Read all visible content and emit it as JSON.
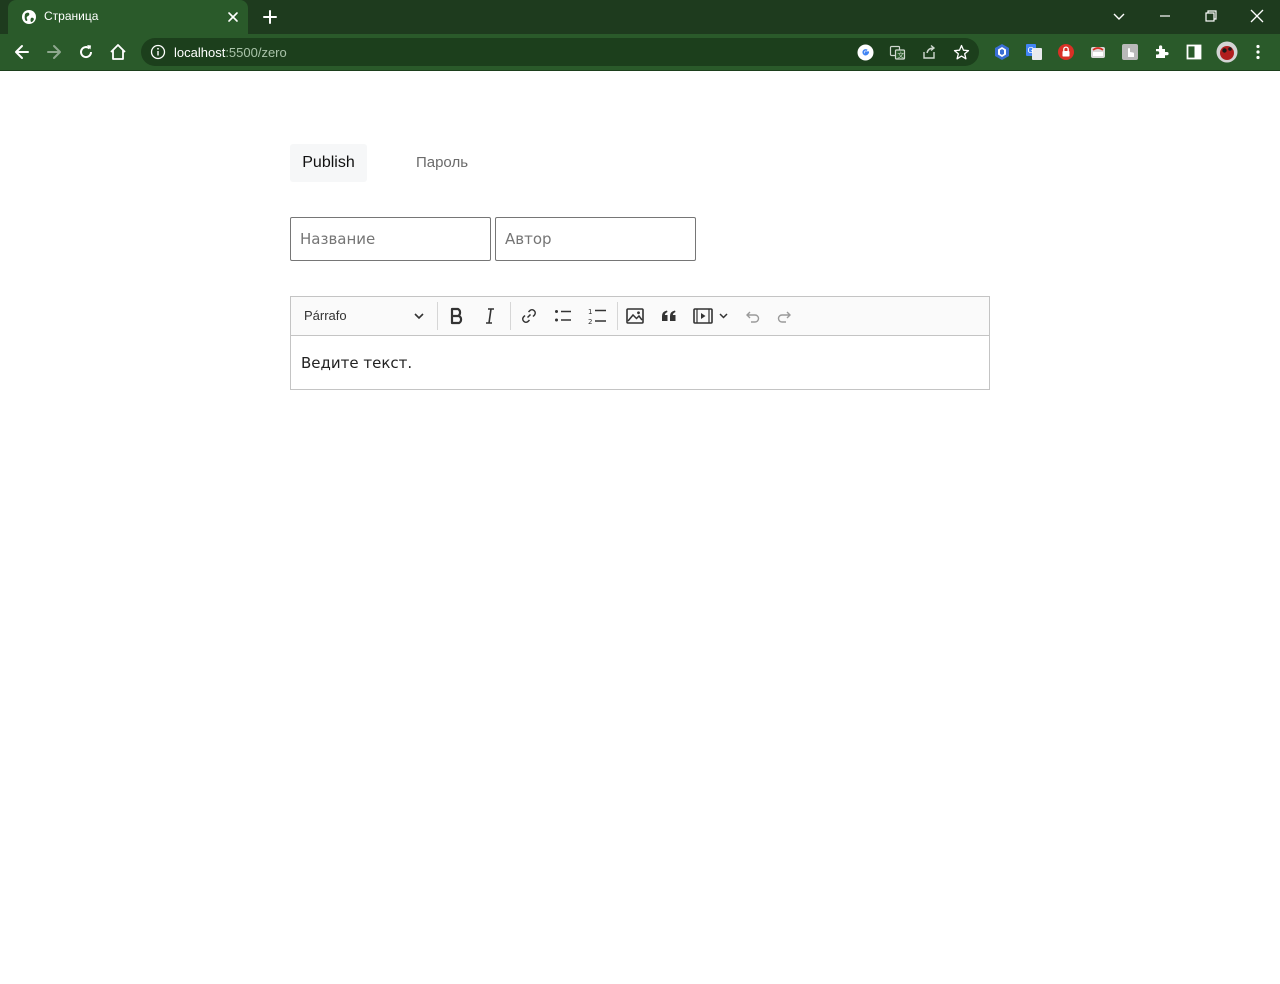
{
  "browser": {
    "tab_title": "Страница",
    "url_host": "localhost",
    "url_path": ":5500/zero"
  },
  "page": {
    "tabs": [
      {
        "label": "Publish",
        "active": true
      },
      {
        "label": "Пароль",
        "active": false
      }
    ],
    "fields": {
      "title_placeholder": "Название",
      "author_placeholder": "Автор"
    },
    "editor": {
      "heading_option": "Párrafo",
      "placeholder": "Ведите текст.",
      "toolbar_icons": [
        "bold-icon",
        "italic-icon",
        "link-icon",
        "bulleted-list-icon",
        "numbered-list-icon",
        "image-icon",
        "blockquote-icon",
        "media-embed-icon",
        "undo-icon",
        "redo-icon"
      ]
    }
  },
  "colors": {
    "tabstrip": "#1e3b1e",
    "toolbar": "#2a5a2a",
    "omnibox": "#1c3f1c"
  }
}
